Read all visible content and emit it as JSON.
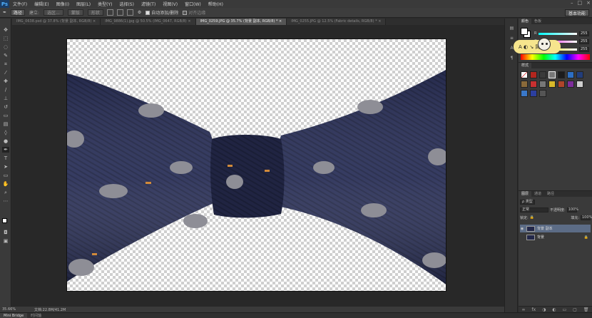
{
  "app": {
    "logo": "Ps"
  },
  "menu": [
    "文件(F)",
    "编辑(E)",
    "图像(I)",
    "图层(L)",
    "类型(Y)",
    "选择(S)",
    "滤镜(T)",
    "视图(V)",
    "窗口(W)",
    "帮助(H)"
  ],
  "window_controls": [
    "–",
    "□",
    "×"
  ],
  "options": {
    "tool_mode": "路径",
    "btn_select": "选区...",
    "btn_mask": "蒙版",
    "btn_shape": "形状",
    "auto_add_delete": "自动添加/删除",
    "align_edges": "对齐边缘",
    "workspace": "基本功能"
  },
  "tabs": [
    {
      "label": "IMG_0638.psd @ 37.8% (背景 副本, RGB/8) ×",
      "active": false
    },
    {
      "label": "IMG_9886(1).jpg @ 50.5% (IMG_0647, RGB/8) ×",
      "active": false
    },
    {
      "label": "IMG_0259.JPG @ 35.7% (背景 副本, RGB/8) * ×",
      "active": true
    },
    {
      "label": "IMG_0255.JPG @ 12.5% (Fabric details, RGB/8) * ×",
      "active": false
    }
  ],
  "status": {
    "zoom": "35.66%",
    "doc": "文档:22.8M/41.2M"
  },
  "bottom_tabs": [
    "Mini Bridge",
    "时间轴"
  ],
  "color_panel": {
    "tabs": [
      "颜色",
      "色板"
    ],
    "channels": [
      {
        "label": "R",
        "value": "255"
      },
      {
        "label": "G",
        "value": "255"
      },
      {
        "label": "B",
        "value": "255"
      }
    ],
    "tooltip": "A ◐ ↘ 简"
  },
  "styles_panel": {
    "tabs": [
      "样式"
    ]
  },
  "layers_panel": {
    "tabs": [
      "图层",
      "通道",
      "路径"
    ],
    "filter_label": "ρ 类型",
    "blend_mode": "正常",
    "opacity_label": "不透明度:",
    "opacity_value": "100%",
    "lock_label": "锁定:",
    "fill_label": "填充:",
    "fill_value": "100%",
    "layers": [
      {
        "name": "背景 副本",
        "visible": true,
        "active": true
      },
      {
        "name": "背景",
        "visible": false,
        "active": false
      }
    ]
  },
  "colors": {
    "tie": "#2a3058",
    "elephant": "#8e8e96",
    "selection_highlight": "#5c6c86"
  }
}
